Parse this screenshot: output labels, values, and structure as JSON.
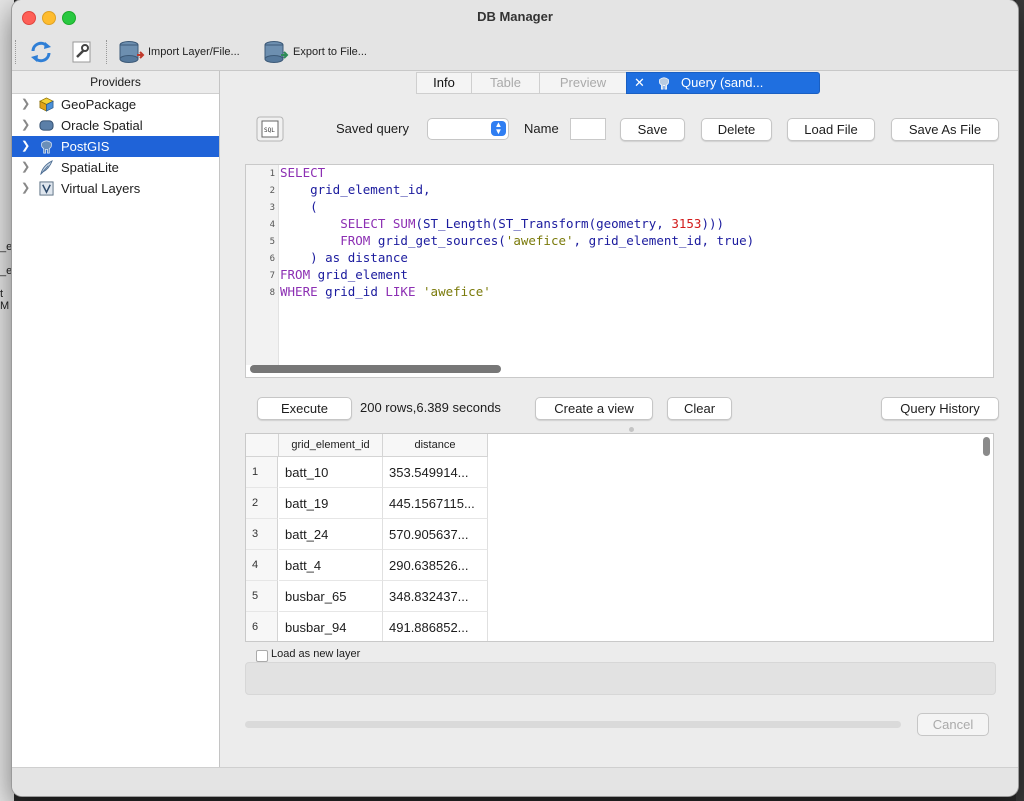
{
  "window": {
    "title": "DB Manager"
  },
  "toolbar": {
    "refresh_icon": "refresh-icon",
    "info_icon": "wrench-icon",
    "import_label": "Import Layer/File...",
    "export_label": "Export to File..."
  },
  "sidebar": {
    "header": "Providers",
    "items": [
      {
        "label": "GeoPackage",
        "icon": "geopackage-icon"
      },
      {
        "label": "Oracle Spatial",
        "icon": "oracle-icon"
      },
      {
        "label": "PostGIS",
        "icon": "postgis-elephant-icon"
      },
      {
        "label": "SpatiaLite",
        "icon": "spatialite-feather-icon"
      },
      {
        "label": "Virtual Layers",
        "icon": "virtual-layers-icon"
      }
    ]
  },
  "tabs": {
    "info": "Info",
    "table": "Table",
    "preview": "Preview",
    "query": "Query (sand..."
  },
  "query_bar": {
    "saved_query_label": "Saved query",
    "name_label": "Name",
    "save": "Save",
    "delete": "Delete",
    "load_file": "Load File",
    "save_as_file": "Save As File"
  },
  "editor": {
    "line_numbers": [
      "1",
      "2",
      "3",
      "4",
      "5",
      "6",
      "7",
      "8"
    ],
    "lines": [
      "SELECT",
      "    grid_element_id,",
      "    (",
      "        SELECT SUM(ST_Length(ST_Transform(geometry, 3153)))",
      "        FROM grid_get_sources('awefice', grid_element_id, true)",
      "    ) as distance",
      "FROM grid_element",
      "WHERE grid_id LIKE 'awefice'"
    ]
  },
  "exec_bar": {
    "execute": "Execute",
    "status": "200 rows,6.389 seconds",
    "create_view": "Create a view",
    "clear": "Clear",
    "history": "Query History"
  },
  "results": {
    "columns": [
      "grid_element_id",
      "distance"
    ],
    "rows": [
      {
        "n": "1",
        "id": "batt_10",
        "distance": "353.549914..."
      },
      {
        "n": "2",
        "id": "batt_19",
        "distance": "445.1567115..."
      },
      {
        "n": "3",
        "id": "batt_24",
        "distance": "570.905637..."
      },
      {
        "n": "4",
        "id": "batt_4",
        "distance": "290.638526..."
      },
      {
        "n": "5",
        "id": "busbar_65",
        "distance": "348.832437..."
      },
      {
        "n": "6",
        "id": "busbar_94",
        "distance": "491.886852..."
      }
    ]
  },
  "footer": {
    "load_as_layer": "Load as new layer",
    "cancel": "Cancel"
  },
  "background_fragments": [
    "_e",
    "_e",
    "t M"
  ]
}
